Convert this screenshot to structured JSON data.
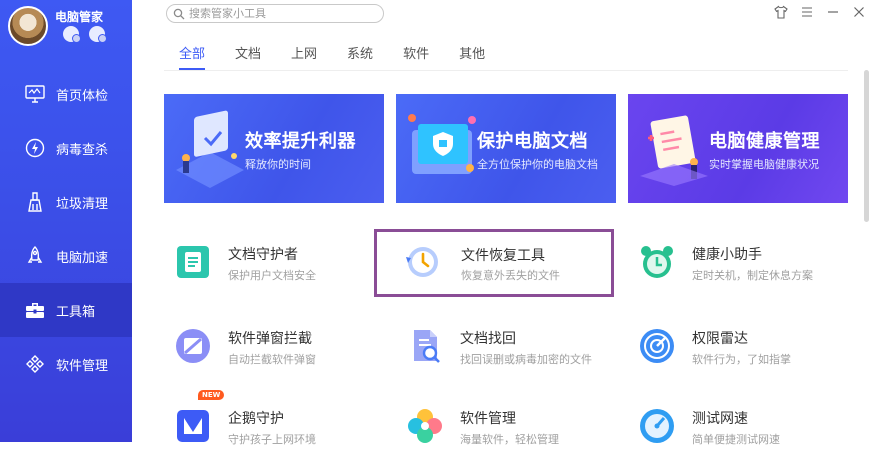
{
  "app": {
    "name": "电脑管家"
  },
  "sidebar": {
    "items": [
      {
        "label": "首页体检",
        "icon": "monitor-icon"
      },
      {
        "label": "病毒查杀",
        "icon": "lightning-shield-icon"
      },
      {
        "label": "垃圾清理",
        "icon": "broom-icon"
      },
      {
        "label": "电脑加速",
        "icon": "rocket-icon"
      },
      {
        "label": "工具箱",
        "icon": "toolbox-icon",
        "active": true
      },
      {
        "label": "软件管理",
        "icon": "software-grid-icon"
      }
    ]
  },
  "search": {
    "placeholder": "搜索管家小工具",
    "value": ""
  },
  "tabs": [
    {
      "label": "全部",
      "active": true
    },
    {
      "label": "文档"
    },
    {
      "label": "上网"
    },
    {
      "label": "系统"
    },
    {
      "label": "软件"
    },
    {
      "label": "其他"
    }
  ],
  "banners": [
    {
      "title": "效率提升利器",
      "subtitle": "释放你的时间"
    },
    {
      "title": "保护电脑文档",
      "subtitle": "全方位保护你的电脑文档"
    },
    {
      "title": "电脑健康管理",
      "subtitle": "实时掌握电脑健康状况"
    }
  ],
  "tools": [
    {
      "name": "文档守护者",
      "desc": "保护用户文档安全",
      "icon": "document-guard-icon"
    },
    {
      "name": "文件恢复工具",
      "desc": "恢复意外丢失的文件",
      "icon": "file-restore-clock-icon",
      "highlighted": true
    },
    {
      "name": "健康小助手",
      "desc": "定时关机，制定休息方案",
      "icon": "alarm-clock-icon"
    },
    {
      "name": "软件弹窗拦截",
      "desc": "自动拦截软件弹窗",
      "icon": "popup-block-icon"
    },
    {
      "name": "文档找回",
      "desc": "找回误删或病毒加密的文件",
      "icon": "document-search-icon"
    },
    {
      "name": "权限雷达",
      "desc": "软件行为，了如指掌",
      "icon": "radar-icon"
    },
    {
      "name": "企鹅守护",
      "desc": "守护孩子上网环境",
      "icon": "penguin-shield-icon",
      "badge": "NEW"
    },
    {
      "name": "软件管理",
      "desc": "海量软件，轻松管理",
      "icon": "clover-icon"
    },
    {
      "name": "测试网速",
      "desc": "简单便捷测试网速",
      "icon": "speedometer-icon"
    }
  ],
  "colors": {
    "sidebar": "#3b4fe8",
    "sidebar_active": "#2f38c6",
    "accent": "#3d5bf6",
    "banner_blue": "#4258ee",
    "banner_purple": "#633fea",
    "highlight_border": "#8a4d96"
  }
}
